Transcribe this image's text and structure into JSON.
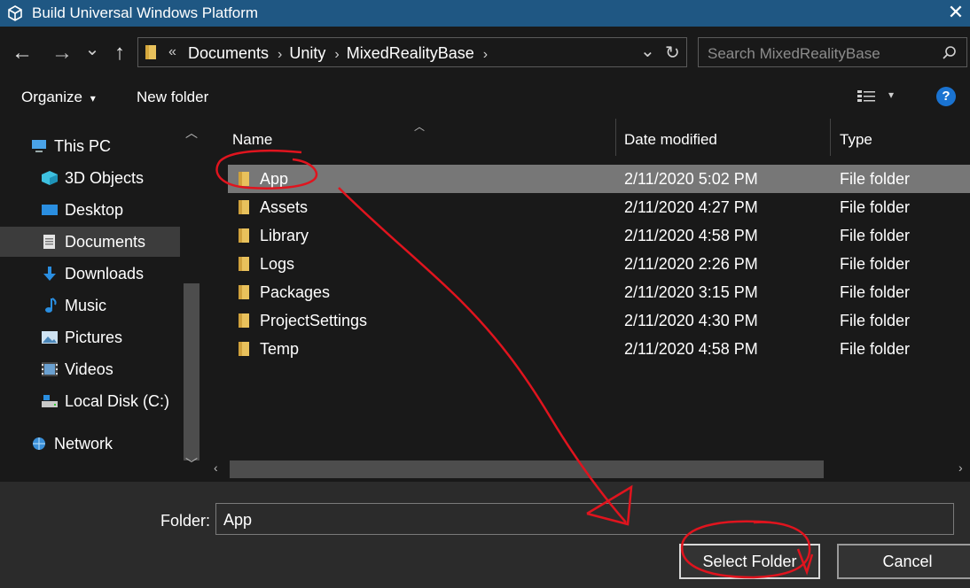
{
  "window": {
    "title": "Build Universal Windows Platform",
    "close_glyph": "✕"
  },
  "nav": {
    "back_glyph": "←",
    "forward_glyph": "→",
    "recent_glyph": "⌄",
    "up_glyph": "↑",
    "breadcrumb_prefix": "«",
    "breadcrumbs": [
      "Documents",
      "Unity",
      "MixedRealityBase"
    ],
    "dropdown_glyph": "⌄",
    "refresh_glyph": "↻",
    "search_placeholder": "Search MixedRealityBase",
    "search_icon": "search-icon"
  },
  "toolbar": {
    "organize_label": "Organize",
    "organize_caret": "▾",
    "new_folder_label": "New folder",
    "view_caret": "▾",
    "help_glyph": "?"
  },
  "sidebar": {
    "items": [
      {
        "label": "This PC",
        "icon": "computer-icon"
      },
      {
        "label": "3D Objects",
        "icon": "cube-icon"
      },
      {
        "label": "Desktop",
        "icon": "desktop-icon"
      },
      {
        "label": "Documents",
        "icon": "documents-icon",
        "selected": true
      },
      {
        "label": "Downloads",
        "icon": "download-icon"
      },
      {
        "label": "Music",
        "icon": "music-icon"
      },
      {
        "label": "Pictures",
        "icon": "pictures-icon"
      },
      {
        "label": "Videos",
        "icon": "videos-icon"
      },
      {
        "label": "Local Disk (C:)",
        "icon": "drive-icon"
      },
      {
        "label": "Network",
        "icon": "network-icon"
      }
    ]
  },
  "filelist": {
    "columns": [
      "Name",
      "Date modified",
      "Type"
    ],
    "rows": [
      {
        "name": "App",
        "date": "2/11/2020 5:02 PM",
        "type": "File folder",
        "selected": true
      },
      {
        "name": "Assets",
        "date": "2/11/2020 4:27 PM",
        "type": "File folder"
      },
      {
        "name": "Library",
        "date": "2/11/2020 4:58 PM",
        "type": "File folder"
      },
      {
        "name": "Logs",
        "date": "2/11/2020 2:26 PM",
        "type": "File folder"
      },
      {
        "name": "Packages",
        "date": "2/11/2020 3:15 PM",
        "type": "File folder"
      },
      {
        "name": "ProjectSettings",
        "date": "2/11/2020 4:30 PM",
        "type": "File folder"
      },
      {
        "name": "Temp",
        "date": "2/11/2020 4:58 PM",
        "type": "File folder"
      }
    ]
  },
  "footer": {
    "folder_label": "Folder:",
    "folder_value": "App",
    "select_button": "Select Folder",
    "cancel_button": "Cancel"
  },
  "colors": {
    "titlebar": "#1f5783",
    "background": "#191919",
    "selected_row": "#777777",
    "annotation": "#e0141e",
    "folder": "#e8c15c"
  }
}
